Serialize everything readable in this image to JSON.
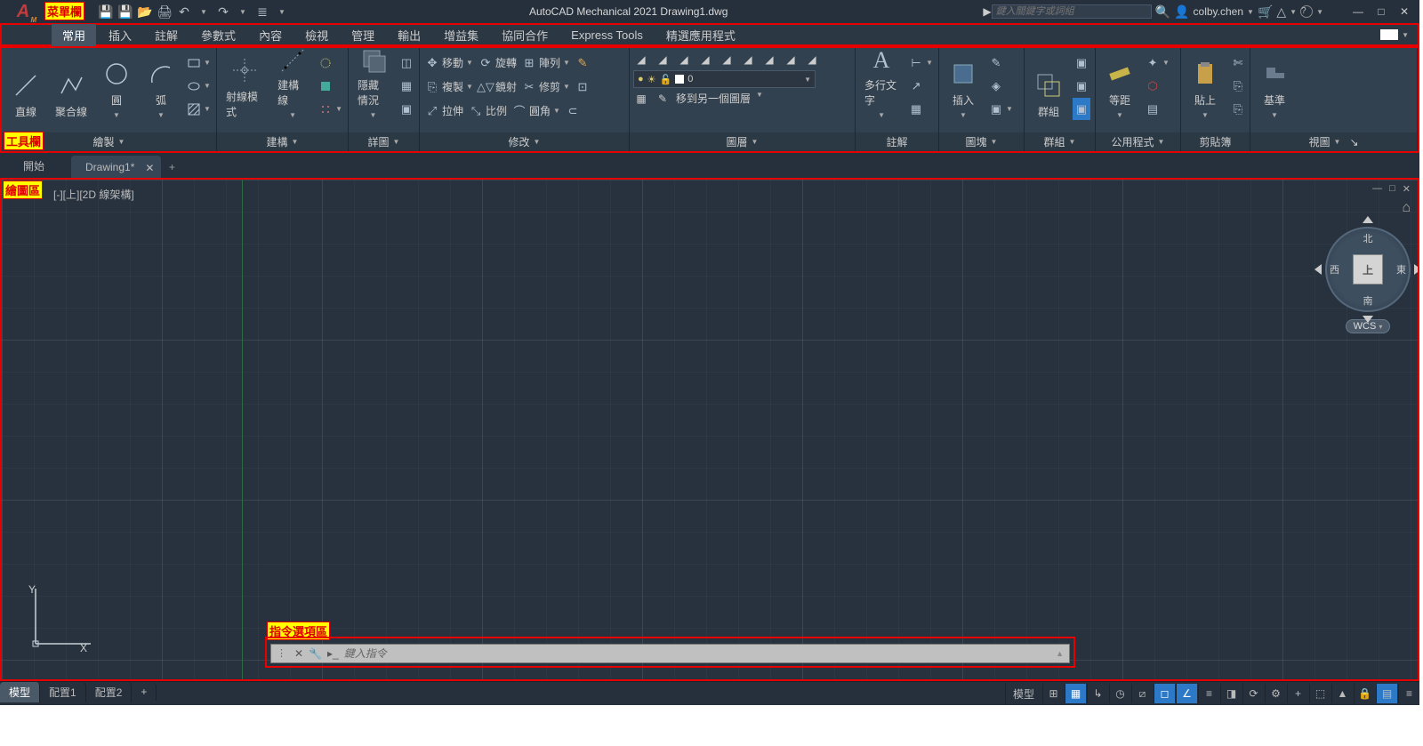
{
  "title_bar": {
    "logo": "A",
    "logo_sub": "M",
    "app_title": "AutoCAD Mechanical 2021   Drawing1.dwg",
    "search_placeholder": "鍵入關鍵字或詞組",
    "user_name": "colby.chen",
    "cart_icon": "🛒",
    "help_icon": "?"
  },
  "annotations": {
    "menu_bar": "菜單欄",
    "toolbar": "工具欄",
    "draw_area": "繪圖區",
    "command_area": "指令選項區"
  },
  "menu": {
    "items": [
      "常用",
      "插入",
      "註解",
      "參數式",
      "內容",
      "檢視",
      "管理",
      "輸出",
      "增益集",
      "協同合作",
      "Express Tools",
      "精選應用程式"
    ],
    "active_index": 0
  },
  "ribbon": {
    "panels": [
      {
        "title": "繪製",
        "buttons": [
          {
            "label": "直線"
          },
          {
            "label": "聚合線"
          },
          {
            "label": "圓"
          },
          {
            "label": "弧"
          }
        ]
      },
      {
        "title": "建構",
        "buttons": [
          {
            "label": "射線模式"
          },
          {
            "label": "建構線"
          }
        ]
      },
      {
        "title": "詳圖",
        "buttons": [
          {
            "label": "隱藏情況"
          }
        ]
      },
      {
        "title": "修改",
        "rows": [
          [
            "移動",
            "旋轉",
            "陣列"
          ],
          [
            "複製",
            "鏡射",
            "修剪"
          ],
          [
            "拉伸",
            "比例",
            "圓角"
          ]
        ]
      },
      {
        "title": "圖層",
        "layer_value": "0",
        "move_layer": "移到另一個圖層"
      },
      {
        "title": "註解",
        "buttons": [
          {
            "label": "多行文字"
          }
        ]
      },
      {
        "title": "圖塊",
        "buttons": [
          {
            "label": "插入"
          }
        ]
      },
      {
        "title": "群組",
        "buttons": [
          {
            "label": "群組"
          }
        ]
      },
      {
        "title": "公用程式",
        "buttons": [
          {
            "label": "等距"
          }
        ]
      },
      {
        "title": "剪貼簿",
        "buttons": [
          {
            "label": "貼上"
          }
        ]
      },
      {
        "title": "視圖",
        "buttons": [
          {
            "label": "基準"
          }
        ]
      }
    ]
  },
  "file_tabs": {
    "start": "開始",
    "drawing": "Drawing1*"
  },
  "drawing_area": {
    "view_label": "[-][上][2D 線架構]",
    "y_label": "Y",
    "x_label": "X",
    "viewcube": {
      "n": "北",
      "s": "南",
      "e": "東",
      "w": "西",
      "top": "上"
    },
    "wcs": "WCS"
  },
  "command": {
    "placeholder": "鍵入指令",
    "arrow_up": "▲"
  },
  "status": {
    "layouts": [
      "模型",
      "配置1",
      "配置2"
    ],
    "active_layout": 0,
    "model_label": "模型"
  }
}
